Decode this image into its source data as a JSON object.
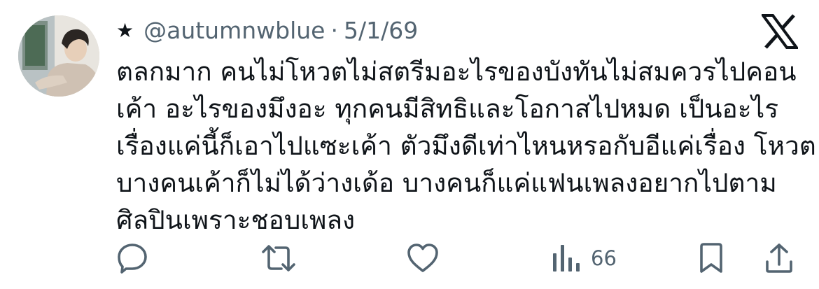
{
  "post": {
    "handle_prefix": "★",
    "handle": "@autumnwblue",
    "separator": "·",
    "date": "5/1/69",
    "text_lines": [
      "ตลกมาก คนไม่โหวตไม่สตรีมอะไรของบังทันไม่สมควรไปคอน",
      "เค้า อะไรของมึงอะ ทุกคนมีสิทธิและโอกาสไปหมด เป็นอะไร",
      "เรื่องแค่นี้ก็เอาไปแซะเค้า ตัวมึงดีเท่าไหนหรอกับอีแค่เรื่อง โหวต",
      "บางคนเค้าก็ไม่ได้ว่างเด้อ บางคนก็แค่แฟนเพลงอยากไปตาม",
      "ศิลปินเพราะชอบเพลง"
    ]
  },
  "actions": {
    "views_count": "66"
  },
  "icons": {
    "avatar": "avatar",
    "brand": "x-logo-icon",
    "reply": "reply-icon",
    "repost": "repost-icon",
    "like": "heart-icon",
    "views": "views-icon",
    "bookmark": "bookmark-icon",
    "share": "share-icon"
  },
  "colors": {
    "text": "#0f1419",
    "secondary": "#536471",
    "background": "#ffffff"
  }
}
